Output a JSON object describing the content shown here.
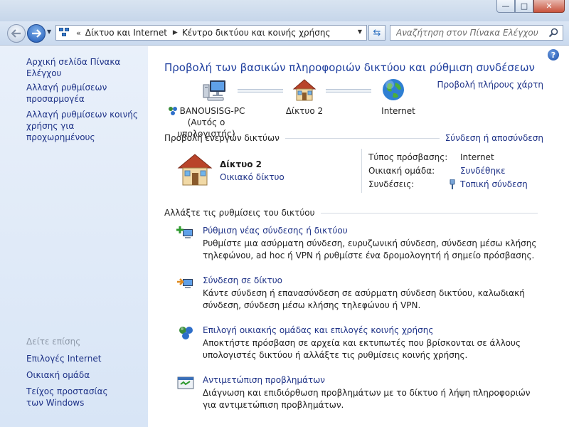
{
  "window": {
    "min_label": "—",
    "max_label": "□",
    "close_label": "✕"
  },
  "nav": {
    "breadcrumb_chevron": "«",
    "crumbs": [
      "Δίκτυο και Internet",
      "Κέντρο δικτύου και κοινής χρήσης"
    ],
    "search_placeholder": "Αναζήτηση στον Πίνακα Ελέγχου"
  },
  "sidebar": {
    "home": "Αρχική σελίδα Πίνακα Ελέγχου",
    "adapter_settings": "Αλλαγή ρυθμίσεων προσαρμογέα",
    "advanced_sharing": "Αλλαγή ρυθμίσεων κοινής χρήσης για προχωρημένους",
    "see_also": "Δείτε επίσης",
    "internet_options": "Επιλογές Internet",
    "homegroup": "Οικιακή ομάδα",
    "firewall": "Τείχος προστασίας των Windows"
  },
  "main": {
    "help_label": "?",
    "title": "Προβολή των βασικών πληροφοριών δικτύου και ρύθμιση συνδέσεων",
    "full_map": "Προβολή πλήρους χάρτη",
    "map": {
      "computer_name": "BANOUSISG-PC",
      "computer_sub": "(Αυτός ο υπολογιστής)",
      "network": "Δίκτυο  2",
      "internet": "Internet"
    },
    "active_networks": {
      "title": "Προβολή ενεργών δικτύων",
      "connect_link": "Σύνδεση ή αποσύνδεση",
      "network_name": "Δίκτυο  2",
      "network_type": "Οικιακό δίκτυο",
      "access_type_label": "Τύπος πρόσβασης:",
      "access_type_value": "Internet",
      "homegroup_label": "Οικιακή ομάδα:",
      "homegroup_value": "Συνδέθηκε",
      "connections_label": "Συνδέσεις:",
      "connections_value": "Τοπική σύνδεση"
    },
    "change_settings": {
      "title": "Αλλάξτε τις ρυθμίσεις του δικτύου",
      "tasks": [
        {
          "link": "Ρύθμιση νέας σύνδεσης ή δικτύου",
          "desc": "Ρυθμίστε μια ασύρματη σύνδεση, ευρυζωνική σύνδεση,  σύνδεση μέσω κλήσης τηλεφώνου, ad hoc ή VPN ή ρυθμίστε ένα δρομολογητή ή σημείο πρόσβασης."
        },
        {
          "link": "Σύνδεση σε δίκτυο",
          "desc": "Κάντε σύνδεση ή επανασύνδεση σε ασύρματη σύνδεση δικτύου, καλωδιακή σύνδεση, σύνδεση μέσω κλήσης τηλεφώνου ή VPN."
        },
        {
          "link": "Επιλογή οικιακής ομάδας και επιλογές κοινής χρήσης",
          "desc": "Αποκτήστε πρόσβαση σε αρχεία και εκτυπωτές που βρίσκονται σε άλλους υπολογιστές δικτύου ή αλλάξτε τις ρυθμίσεις κοινής χρήσης."
        },
        {
          "link": "Αντιμετώπιση προβλημάτων",
          "desc": "Διάγνωση και επιδιόρθωση προβλημάτων με το δίκτυο ή λήψη πληροφοριών για αντιμετώπιση προβλημάτων."
        }
      ]
    }
  },
  "icons": {
    "computer": "computer-icon",
    "house": "house-icon",
    "globe": "globe-icon",
    "new_connection": "new-connection-icon",
    "connect_network": "connect-network-icon",
    "homegroup": "homegroup-icon",
    "troubleshoot": "troubleshoot-icon",
    "ethernet": "ethernet-plug-icon"
  },
  "colors": {
    "link": "#1e3287",
    "title": "#1e3e9e",
    "sidebar_bg": "#e3ecf8"
  }
}
